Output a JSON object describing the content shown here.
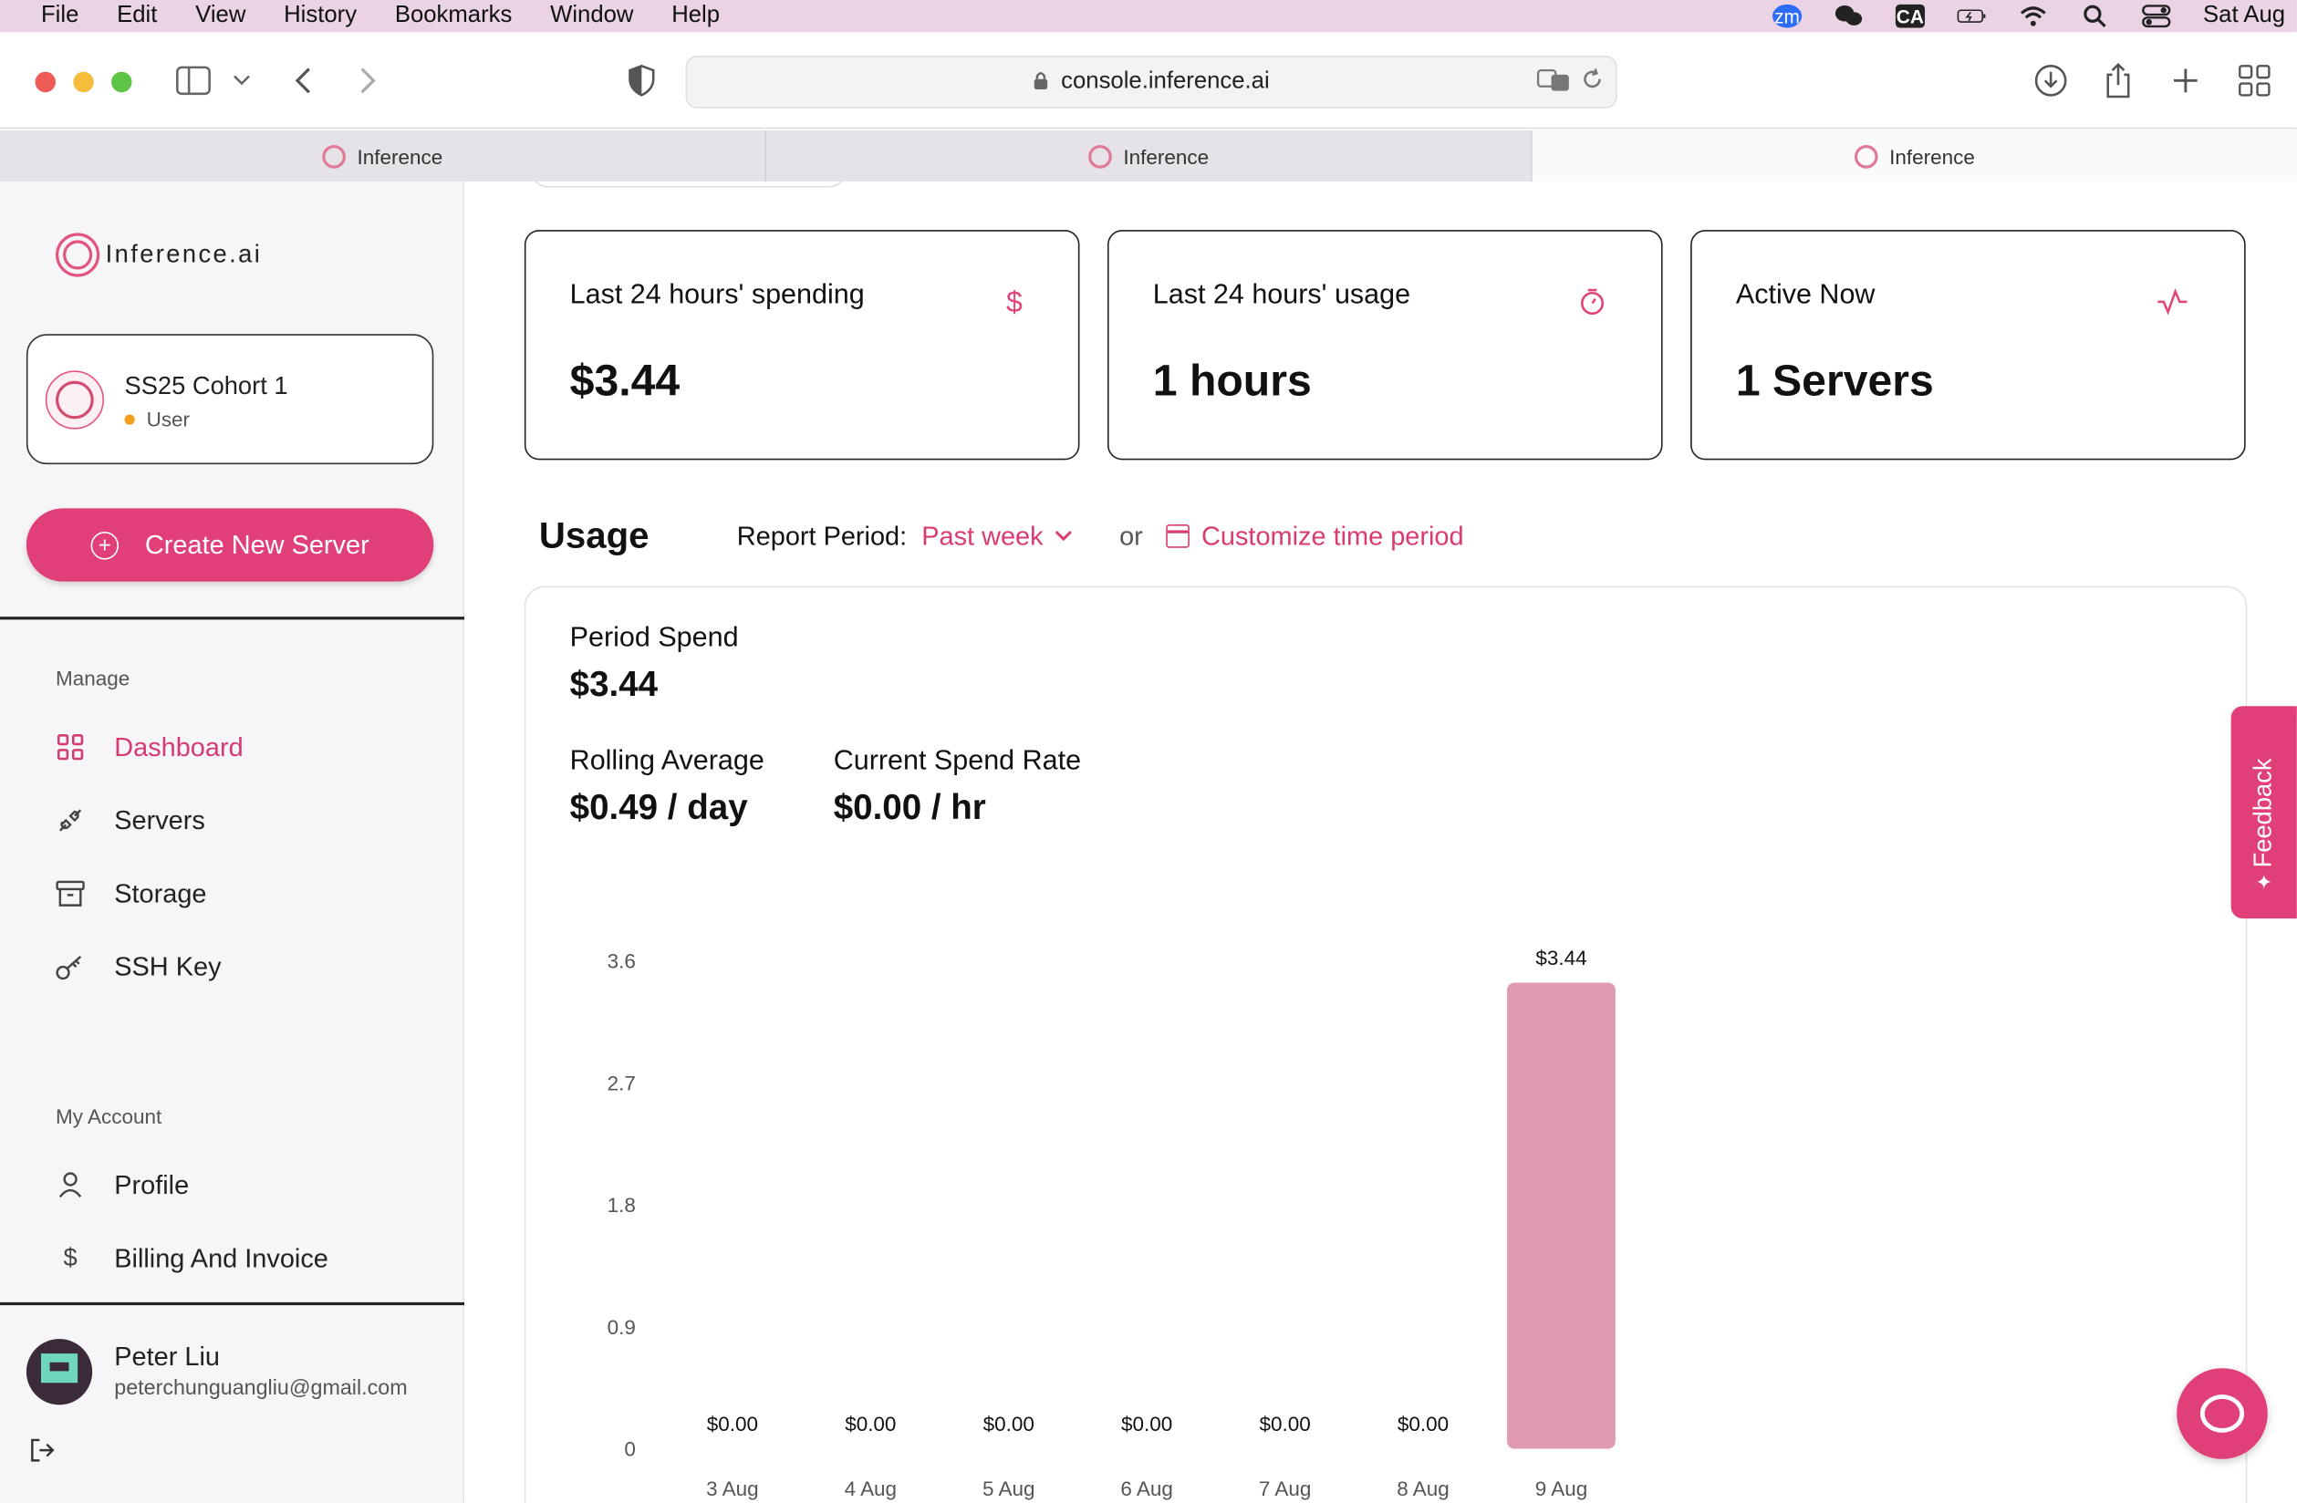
{
  "menubar": {
    "items": [
      "File",
      "Edit",
      "View",
      "History",
      "Bookmarks",
      "Window",
      "Help"
    ],
    "clock": "Sat Aug"
  },
  "browser": {
    "url": "console.inference.ai",
    "tabs": [
      {
        "label": "Inference"
      },
      {
        "label": "Inference"
      },
      {
        "label": "Inference"
      }
    ]
  },
  "sidebar": {
    "logo_text": "Inference.ai",
    "org": {
      "name": "SS25 Cohort 1",
      "role": "User"
    },
    "create_button": "Create New Server",
    "manage_label": "Manage",
    "manage_items": [
      {
        "label": "Dashboard",
        "icon": "grid-icon",
        "active": true
      },
      {
        "label": "Servers",
        "icon": "plug-icon"
      },
      {
        "label": "Storage",
        "icon": "archive-icon"
      },
      {
        "label": "SSH Key",
        "icon": "key-icon"
      }
    ],
    "account_label": "My Account",
    "account_items": [
      {
        "label": "Profile",
        "icon": "user-icon"
      },
      {
        "label": "Billing And Invoice",
        "icon": "dollar-icon"
      }
    ],
    "user": {
      "name": "Peter Liu",
      "email": "peterchunguangliu@gmail.com"
    }
  },
  "stats": [
    {
      "label": "Last 24 hours' spending",
      "value": "$3.44",
      "icon": "dollar-icon"
    },
    {
      "label": "Last 24 hours' usage",
      "value": "1 hours",
      "icon": "stopwatch-icon"
    },
    {
      "label": "Active Now",
      "value": "1 Servers",
      "icon": "activity-icon"
    }
  ],
  "usage": {
    "title": "Usage",
    "report_period_label": "Report Period:",
    "report_period_value": "Past week",
    "or": "or",
    "customize": "Customize time period",
    "period_spend_label": "Period Spend",
    "period_spend_value": "$3.44",
    "rolling_avg_label": "Rolling Average",
    "rolling_avg_value": "$0.49 / day",
    "spend_rate_label": "Current Spend Rate",
    "spend_rate_value": "$0.00 / hr"
  },
  "feedback_label": "Feedback",
  "colors": {
    "accent": "#e13f7a",
    "bar": "#e09ab2"
  },
  "chart_data": {
    "type": "bar",
    "categories": [
      "3 Aug",
      "4 Aug",
      "5 Aug",
      "6 Aug",
      "7 Aug",
      "8 Aug",
      "9 Aug"
    ],
    "values": [
      0,
      0,
      0,
      0,
      0,
      0,
      3.44
    ],
    "data_labels": [
      "$0.00",
      "$0.00",
      "$0.00",
      "$0.00",
      "$0.00",
      "$0.00",
      "$3.44"
    ],
    "yticks": [
      "0",
      "0.9",
      "1.8",
      "2.7",
      "3.6"
    ],
    "ylim": [
      0,
      3.6
    ],
    "grid": false
  }
}
